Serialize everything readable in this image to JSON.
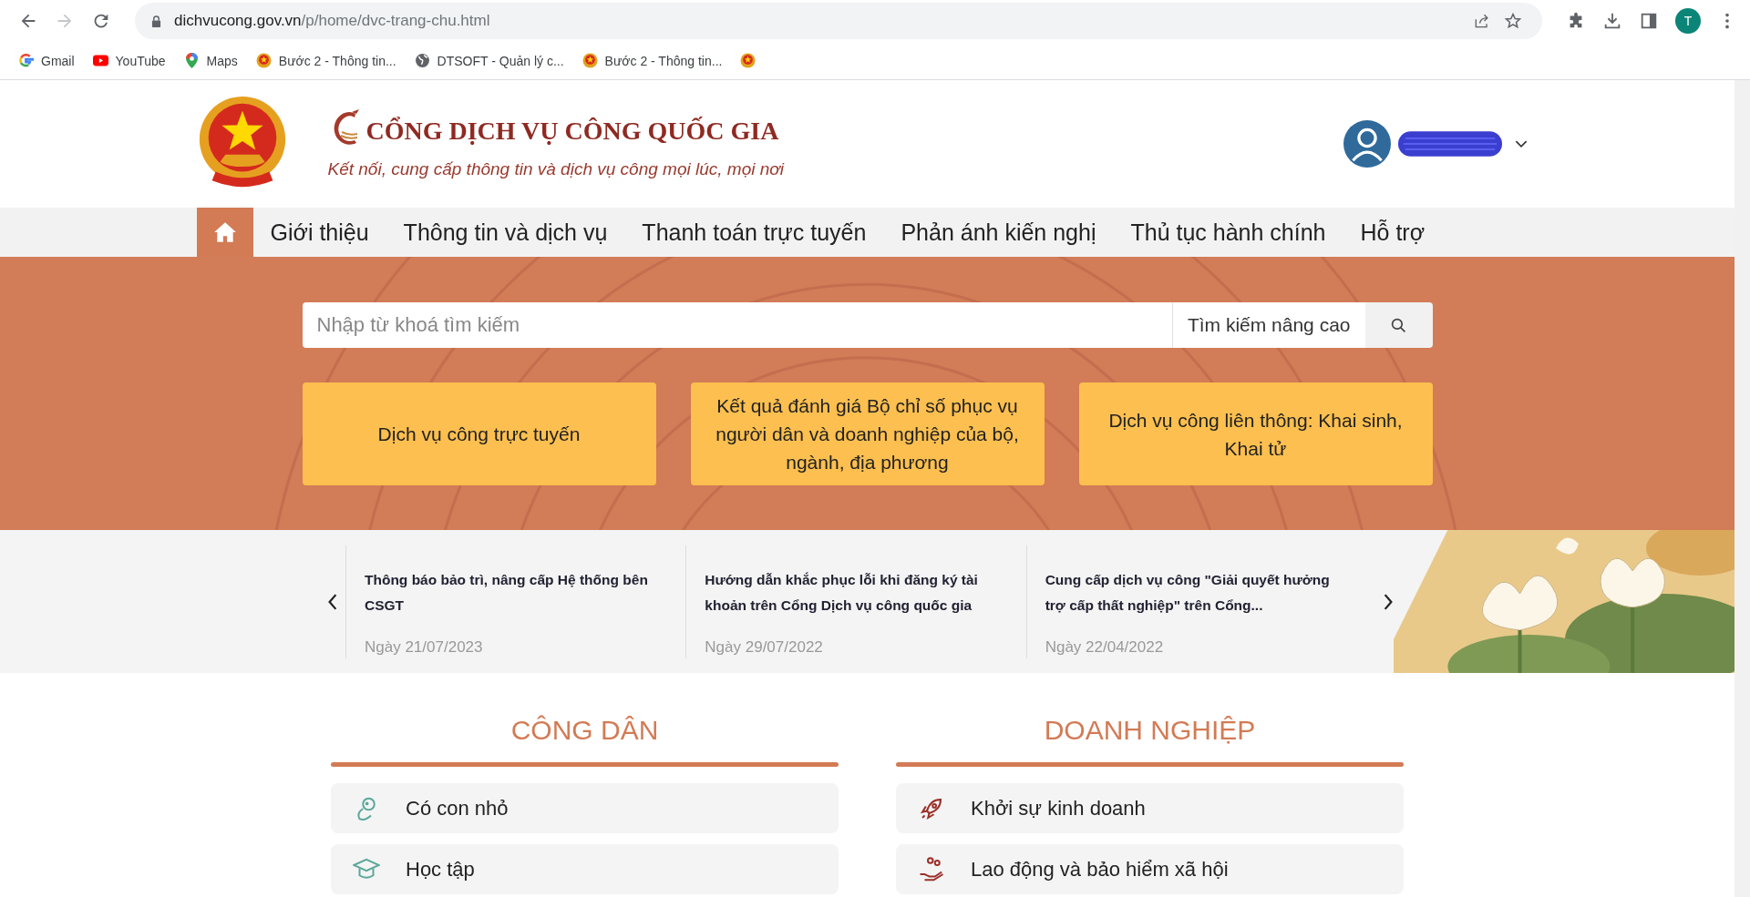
{
  "browser": {
    "url_host": "dichvucong.gov.vn",
    "url_path": "/p/home/dvc-trang-chu.html",
    "profile_initial": "T",
    "bookmarks": [
      {
        "label": "Gmail",
        "kind": "google"
      },
      {
        "label": "YouTube",
        "kind": "youtube"
      },
      {
        "label": "Maps",
        "kind": "maps"
      },
      {
        "label": "Bước 2 - Thông tin...",
        "kind": "emblem"
      },
      {
        "label": "DTSOFT - Quản lý c...",
        "kind": "globe"
      },
      {
        "label": "Bước 2 - Thông tin...",
        "kind": "emblem"
      },
      {
        "kind": "emblem"
      }
    ]
  },
  "header": {
    "title": "CỔNG DỊCH VỤ CÔNG QUỐC GIA",
    "slogan": "Kết nối, cung cấp thông tin và dịch vụ công mọi lúc, mọi nơi"
  },
  "nav": [
    {
      "kind": "home",
      "selected": true
    },
    {
      "label": "Giới thiệu",
      "selected": false
    },
    {
      "label": "Thông tin và dịch vụ",
      "selected": false
    },
    {
      "label": "Thanh toán trực tuyến",
      "selected": false
    },
    {
      "label": "Phản ánh kiến nghị",
      "selected": false
    },
    {
      "label": "Thủ tục hành chính",
      "selected": false
    },
    {
      "label": "Hỗ trợ",
      "selected": false
    }
  ],
  "search": {
    "placeholder": "Nhập từ khoá tìm kiếm",
    "advanced": "Tìm kiếm nâng cao"
  },
  "quick_links": [
    "Dịch vụ công trực tuyến",
    "Kết quả đánh giá Bộ chỉ số phục vụ người dân và doanh nghiệp của bộ, ngành, địa phương",
    "Dịch vụ công liên thông: Khai sinh, Khai tử"
  ],
  "news": [
    {
      "title": "Thông báo bảo trì, nâng cấp Hệ thống bên CSGT",
      "date": "Ngày 21/07/2023"
    },
    {
      "title": "Hướng dẫn khắc phục lỗi khi đăng ký tài khoản trên Cổng Dịch vụ công quốc gia",
      "date": "Ngày 29/07/2022"
    },
    {
      "title": "Cung cấp dịch vụ công \"Giải quyết hưởng trợ cấp thất nghiệp\" trên Cổng...",
      "date": "Ngày 22/04/2022"
    }
  ],
  "sections": [
    {
      "heading": "CÔNG DÂN",
      "items": [
        "Có con nhỏ",
        "Học tập"
      ]
    },
    {
      "heading": "DOANH NGHIỆP",
      "items": [
        "Khởi sự kinh doanh",
        "Lao động và bảo hiểm xã hội"
      ]
    }
  ]
}
